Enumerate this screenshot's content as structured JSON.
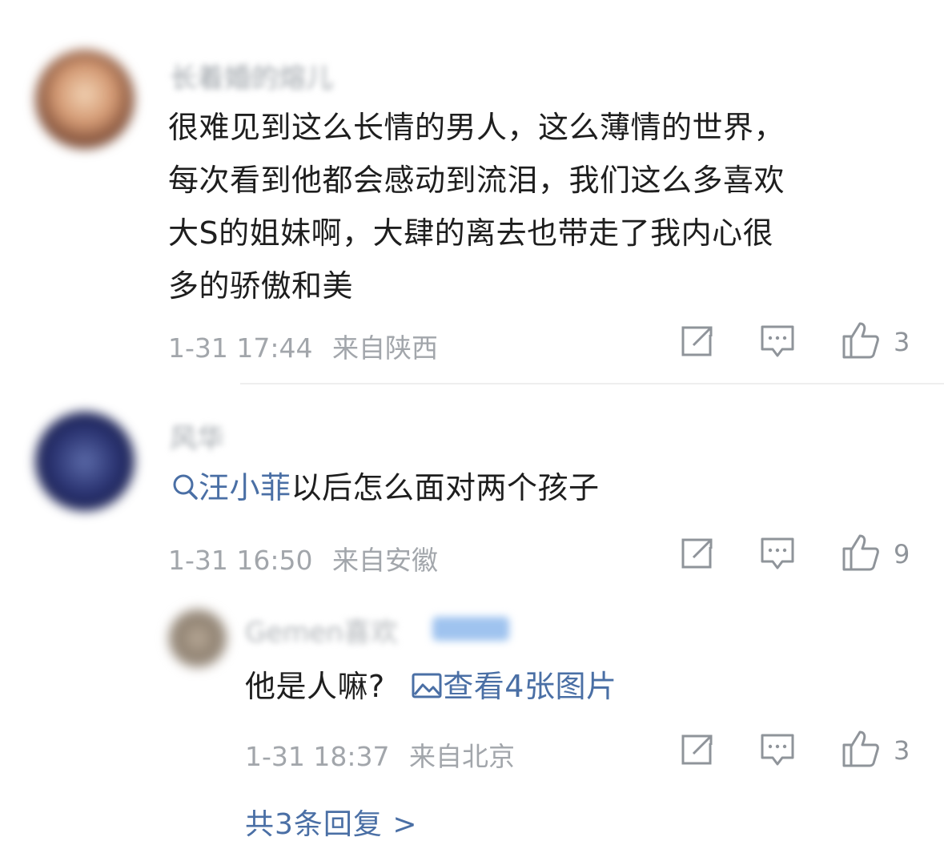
{
  "comments": [
    {
      "username": "长着婚的熔儿",
      "text_lines": [
        "很难见到这么长情的男人，这么薄情的世界，",
        "每次看到他都会感动到流泪，我们这么多喜欢",
        "大S的姐妹啊，大肆的离去也带走了我内心很",
        "多的骄傲和美"
      ],
      "time": "1-31 17:44",
      "location": "来自陕西",
      "likes": "3"
    },
    {
      "username": "风华",
      "topic": "汪小菲",
      "text": "以后怎么面对两个孩子",
      "time": "1-31 16:50",
      "location": "来自安徽",
      "likes": "9"
    }
  ],
  "reply": {
    "username": "Gemen喜欢",
    "text": "他是人嘛?",
    "image_link": "查看4张图片",
    "time": "1-31 18:37",
    "location": "来自北京",
    "likes": "3"
  },
  "replies_link": "共3条回复 >",
  "icons": {
    "repost": "repost-icon",
    "comment": "comment-icon",
    "like": "like-icon",
    "search": "search-icon",
    "image": "image-icon"
  },
  "colors": {
    "link": "#4a6fa5",
    "meta": "#a2a6ab",
    "icon": "#8f949a"
  }
}
